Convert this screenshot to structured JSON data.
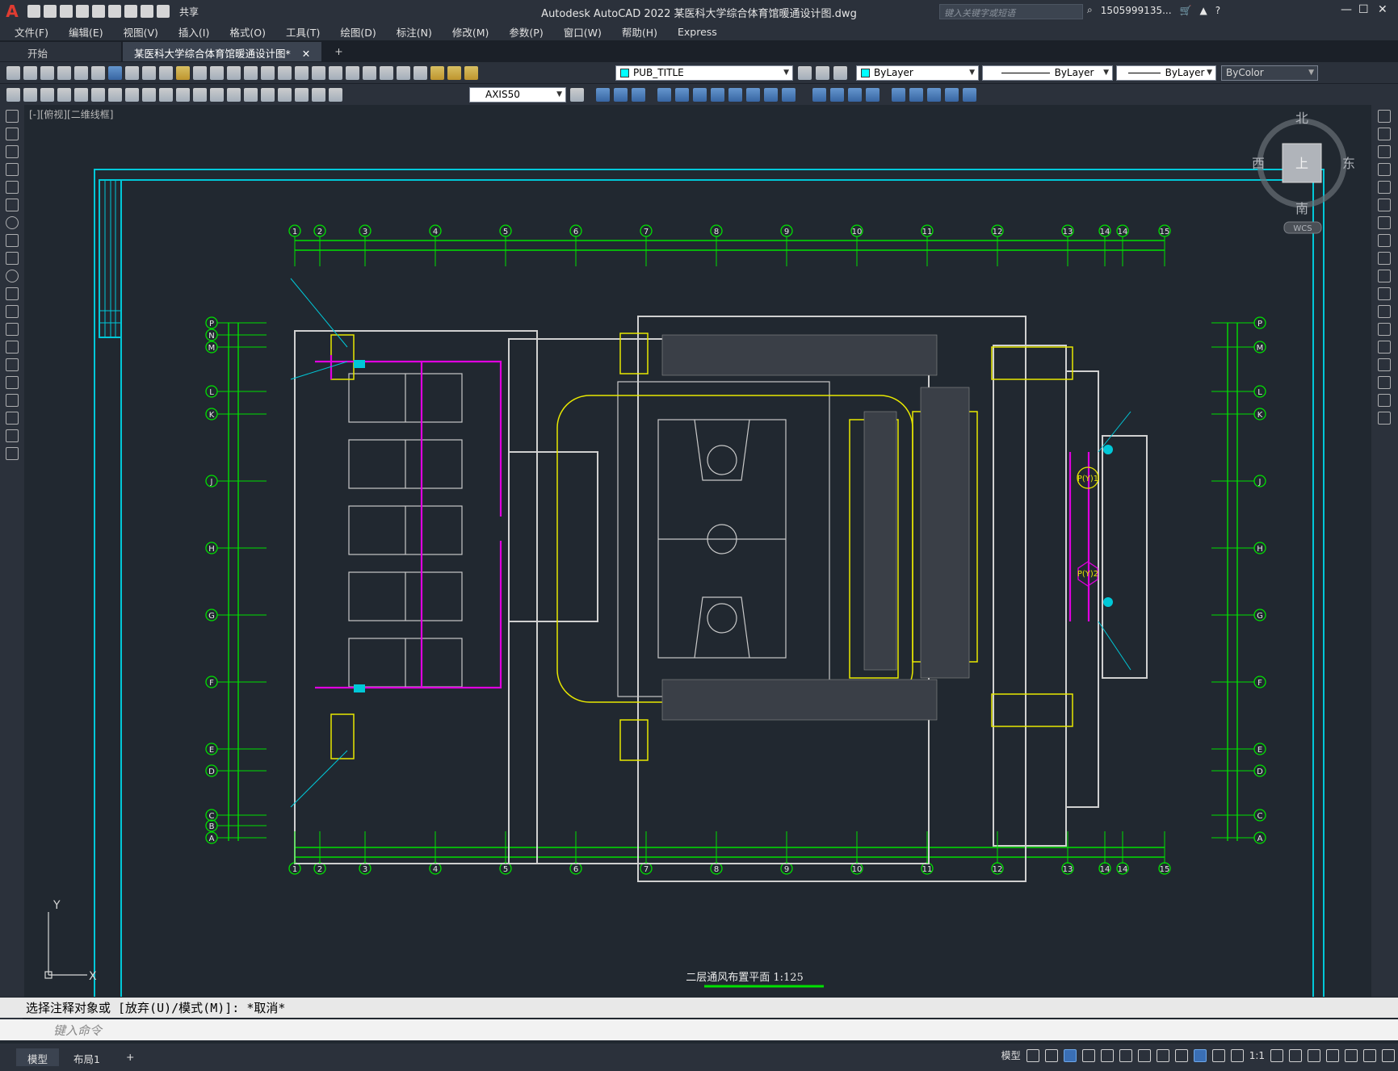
{
  "app": {
    "title": "Autodesk AutoCAD 2022    某医科大学综合体育馆暖通设计图.dwg",
    "share_label": "共享",
    "search_placeholder": "键入关键字或短语",
    "user": "1505999135...",
    "logo": "A"
  },
  "menu": [
    "文件(F)",
    "编辑(E)",
    "视图(V)",
    "插入(I)",
    "格式(O)",
    "工具(T)",
    "绘图(D)",
    "标注(N)",
    "修改(M)",
    "参数(P)",
    "窗口(W)",
    "帮助(H)",
    "Express"
  ],
  "tabs": [
    {
      "label": "开始"
    },
    {
      "label": "某医科大学综合体育馆暖通设计图*"
    }
  ],
  "toolbar": {
    "layer": "PUB_TITLE",
    "color": "ByLayer",
    "linetype": "ByLayer",
    "lineweight": "ByLayer",
    "plotstyle": "ByColor",
    "dimstyle": "AXIS50"
  },
  "viewport": {
    "label": "[-][俯视][二维线框]",
    "viewcube": {
      "north": "北",
      "south": "南",
      "east": "东",
      "west": "西",
      "top": "上",
      "wcs": "WCS"
    },
    "ucs_x": "X",
    "ucs_y": "Y"
  },
  "drawing": {
    "title": "二层通风布置平面   1:125",
    "grid_cols": [
      "1",
      "2",
      "3",
      "4",
      "5",
      "6",
      "7",
      "8",
      "9",
      "10",
      "11",
      "12",
      "13",
      "14",
      "14",
      "15"
    ],
    "grid_rows_left": [
      "P",
      "N",
      "M",
      "L",
      "K",
      "J",
      "H",
      "G",
      "F",
      "E",
      "D",
      "C",
      "B",
      "A"
    ],
    "grid_rows_right": [
      "P",
      "M",
      "L",
      "K",
      "J",
      "H",
      "G",
      "F",
      "E",
      "D",
      "C",
      "A"
    ],
    "marks": [
      "P(Y)1",
      "P(Y)2"
    ]
  },
  "command": {
    "history": "选择注释对象或 [放弃(U)/模式(M)]: *取消*",
    "placeholder": "键入命令"
  },
  "status": {
    "tabs": [
      "模型",
      "布局1"
    ],
    "model_label": "模型",
    "scale": "1:1"
  },
  "colors": {
    "bg": "#212830",
    "grid": "#00e000",
    "frame": "#00c8d8",
    "wall": "#d0d0d0",
    "yellow": "#e8e800",
    "magenta": "#e000e0"
  }
}
